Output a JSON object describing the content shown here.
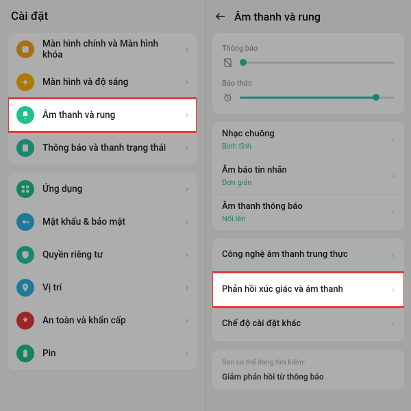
{
  "left": {
    "title": "Cài đặt",
    "groups": [
      {
        "items": [
          {
            "label": "Màn hình chính và Màn hình khóa",
            "icon": "home-icon",
            "color": "#f5a623",
            "highlighted": false
          },
          {
            "label": "Màn hình và độ sáng",
            "icon": "brightness-icon",
            "color": "#ffb300",
            "highlighted": false
          },
          {
            "label": "Âm thanh và rung",
            "icon": "sound-icon",
            "color": "#1ec28b",
            "highlighted": true
          },
          {
            "label": "Thông báo và thanh trạng thái",
            "icon": "notification-icon",
            "color": "#26c6a9",
            "highlighted": false
          }
        ]
      },
      {
        "items": [
          {
            "label": "Ứng dụng",
            "icon": "apps-icon",
            "color": "#1ec28b",
            "highlighted": false
          },
          {
            "label": "Mật khẩu & bảo mật",
            "icon": "lock-icon",
            "color": "#2bb4e0",
            "highlighted": false
          },
          {
            "label": "Quyền riêng tư",
            "icon": "privacy-icon",
            "color": "#26c6a9",
            "highlighted": false
          },
          {
            "label": "Vị trí",
            "icon": "location-icon",
            "color": "#2bb4e0",
            "highlighted": false
          },
          {
            "label": "An toàn và khẩn cấp",
            "icon": "emergency-icon",
            "color": "#e53935",
            "highlighted": false
          },
          {
            "label": "Pin",
            "icon": "battery-icon",
            "color": "#1ec28b",
            "highlighted": false
          }
        ]
      }
    ]
  },
  "right": {
    "title": "Âm thanh và rung",
    "sliders": [
      {
        "label": "Thông báo",
        "icon": "mute-icon",
        "fill": 2
      },
      {
        "label": "Báo thức",
        "icon": "alarm-icon",
        "fill": 88
      }
    ],
    "sound_group": [
      {
        "label": "Nhạc chuông",
        "sub": "Bình tĩnh"
      },
      {
        "label": "Âm báo tin nhắn",
        "sub": "Đơn giản"
      },
      {
        "label": "Âm thanh thông báo",
        "sub": "Nổi lên"
      }
    ],
    "tech_group": [
      {
        "label": "Công nghệ âm thanh trung thực",
        "highlighted": false
      },
      {
        "label": "Phản hồi xúc giác và âm thanh",
        "highlighted": true
      },
      {
        "label": "Chế độ cài đặt khác",
        "highlighted": false
      }
    ],
    "hint_small": "Bạn có thể đang tìm kiếm:",
    "hint_main": "Giảm phản hồi từ thông báo"
  },
  "icons": {
    "home-icon": "#f5a623",
    "brightness-icon": "#ffb300",
    "sound-icon": "#1ec28b",
    "notification-icon": "#26c6a9",
    "apps-icon": "#1ec28b",
    "lock-icon": "#2bb4e0",
    "privacy-icon": "#26c6a9",
    "location-icon": "#2bb4e0",
    "emergency-icon": "#e53935",
    "battery-icon": "#1ec28b"
  }
}
